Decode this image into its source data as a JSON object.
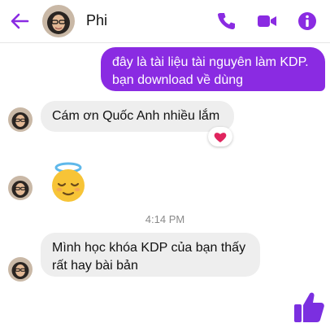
{
  "header": {
    "contact_name": "Phi",
    "icons": [
      "back-arrow-icon",
      "phone-icon",
      "video-camera-icon",
      "info-icon"
    ]
  },
  "colors": {
    "accent": "#8a2be2",
    "incoming_bubble": "#eeeeee",
    "reaction_heart": "#e0245e"
  },
  "messages": [
    {
      "direction": "outgoing",
      "text": "đây là tài liệu tài nguyên làm KDP. bạn download về dùng"
    },
    {
      "direction": "incoming",
      "text": "Cám ơn Quốc Anh nhiều lắm",
      "reaction": "heart-icon"
    },
    {
      "direction": "incoming",
      "emoji": "relieved-face-with-halo-emoji"
    },
    {
      "direction": "incoming",
      "text": "Mình học khóa KDP của bạn thấy rất hay bài bản"
    }
  ],
  "timestamp": "4:14 PM",
  "composer": {
    "quick_reaction": "thumbs-up-icon"
  }
}
